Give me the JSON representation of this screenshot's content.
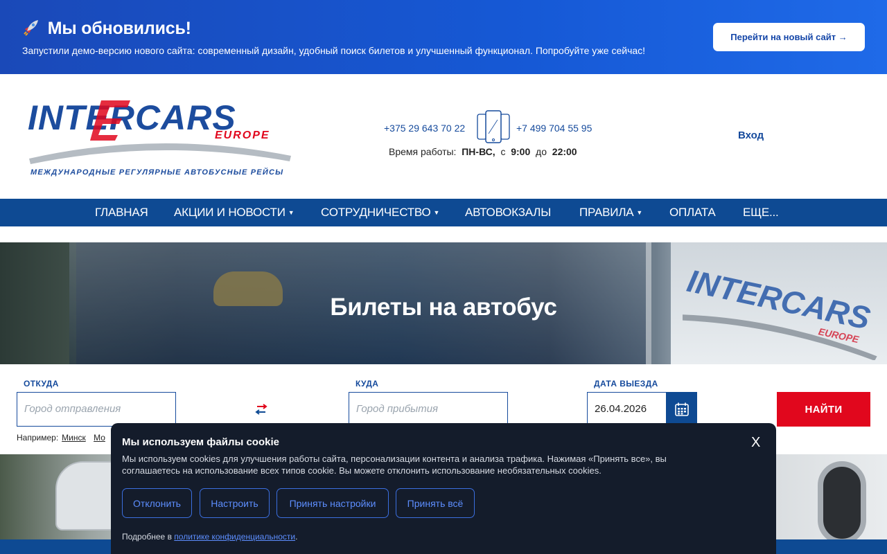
{
  "promo": {
    "title": "Мы обновились!",
    "text": "Запустили демо-версию нового сайта: современный дизайн, удобный поиск билетов и улучшенный функционал. Попробуйте уже сейчас!",
    "button": "Перейти на новый сайт →"
  },
  "header": {
    "logo_main": "INTERCARS",
    "logo_sub": "EUROPE",
    "logo_tagline": "МЕЖДУНАРОДНЫЕ РЕГУЛЯРНЫЕ АВТОБУСНЫЕ РЕЙСЫ",
    "phone1": "+375 29 643 70 22",
    "phone2": "+7 499 704 55 95",
    "hours_label": "Время работы:",
    "hours_days": "ПН-ВС,",
    "hours_from_label": "с",
    "hours_from": "9:00",
    "hours_to_label": "до",
    "hours_to": "22:00",
    "login": "Вход"
  },
  "nav": {
    "items": [
      {
        "label": "ГЛАВНАЯ"
      },
      {
        "label": "АКЦИИ И НОВОСТИ"
      },
      {
        "label": "СОТРУДНИЧЕСТВО"
      },
      {
        "label": "АВТОВОКЗАЛЫ"
      },
      {
        "label": "ПРАВИЛА"
      },
      {
        "label": "ОПЛАТА"
      },
      {
        "label": "ЕЩЕ..."
      }
    ],
    "caret": "▼"
  },
  "hero": {
    "title": "Билеты на автобус"
  },
  "search": {
    "from_label": "ОТКУДА",
    "from_placeholder": "Город отправления",
    "to_label": "КУДА",
    "to_placeholder": "Город прибытия",
    "date_label": "ДАТА ВЫЕЗДА",
    "date_value": "26.04.2026",
    "find_button": "НАЙТИ",
    "example_label": "Например:",
    "example_1": "Минск",
    "example_2": "Мо"
  },
  "cookie": {
    "title": "Мы используем файлы cookie",
    "close": "X",
    "text": "Мы используем cookies для улучшения работы сайта, персонализации контента и анализа трафика. Нажимая «Принять все», вы соглашаетесь на использование всех типов cookie. Вы можете отклонить использование необязательных cookies.",
    "decline": "Отклонить",
    "configure": "Настроить",
    "accept_settings": "Принять настройки",
    "accept_all": "Принять всё",
    "more_prefix": "Подробнее в",
    "more_link": "политике конфиденциальности",
    "more_suffix": "."
  },
  "colors": {
    "brand_blue": "#0e4a93",
    "accent_red": "#e1071d",
    "promo_blue": "#1659d6",
    "cookie_bg": "#141c2b"
  }
}
